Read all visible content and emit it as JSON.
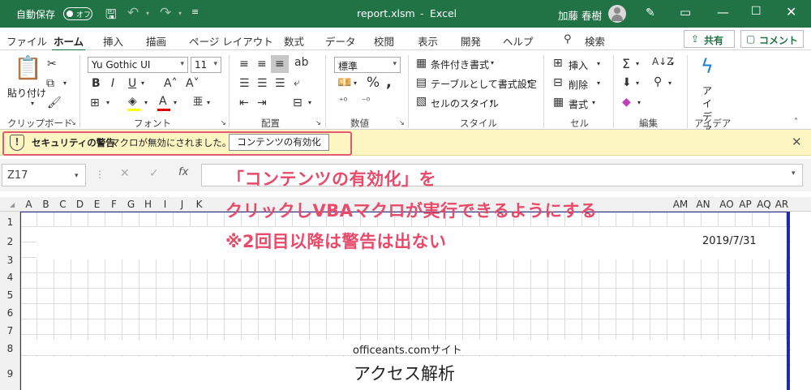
{
  "titlebar": {
    "autosave_label": "自動保存",
    "autosave_state": "オフ",
    "filename": "report.xlsm",
    "separator": "-",
    "app_name": "Excel",
    "user_name": "加藤 春樹"
  },
  "tabs": [
    "ファイル",
    "ホーム",
    "挿入",
    "描画",
    "ページ レイアウト",
    "数式",
    "データ",
    "校閲",
    "表示",
    "開発",
    "ヘルプ"
  ],
  "search_label": "検索",
  "share_label": "共有",
  "comment_label": "コメント",
  "ribbon": {
    "clipboard": {
      "paste": "貼り付け",
      "label": "クリップボード"
    },
    "font": {
      "name": "Yu Gothic UI",
      "size": "11",
      "label": "フォント"
    },
    "alignment": {
      "label": "配置"
    },
    "number": {
      "format": "標準",
      "label": "数値"
    },
    "styles": {
      "conditional": "条件付き書式",
      "table": "テーブルとして書式設定",
      "cell_styles": "セルのスタイル",
      "label": "スタイル"
    },
    "cells": {
      "insert": "挿入",
      "delete": "削除",
      "format": "書式",
      "label": "セル"
    },
    "editing": {
      "label": "編集"
    },
    "ideas": {
      "button": "アイ デア",
      "label": "アイデア"
    }
  },
  "warning": {
    "title": "セキュリティの警告",
    "message": "マクロが無効にされました。",
    "button": "コンテンツの有効化"
  },
  "formula": {
    "namebox": "Z17",
    "fx": "fx"
  },
  "columns": [
    "A",
    "B",
    "C",
    "D",
    "E",
    "F",
    "G",
    "H",
    "I",
    "J",
    "K",
    "AM",
    "AN",
    "AO",
    "AP",
    "AQ",
    "AR"
  ],
  "rows": [
    "1",
    "2",
    "3",
    "4",
    "5",
    "6",
    "7",
    "8",
    "9"
  ],
  "cells": {
    "date": "2019/7/31",
    "site": "officeants.comサイト",
    "title": "アクセス解析"
  },
  "annotation": {
    "line1": "「コンテンツの有効化」を",
    "line2": "クリックしVBAマクロが実行できるようにする",
    "line3": "※2回目以降は警告は出ない"
  },
  "colors": {
    "excel_green": "#217346",
    "annotation": "#e94a6a",
    "warning_bg": "#fdf5c2"
  }
}
